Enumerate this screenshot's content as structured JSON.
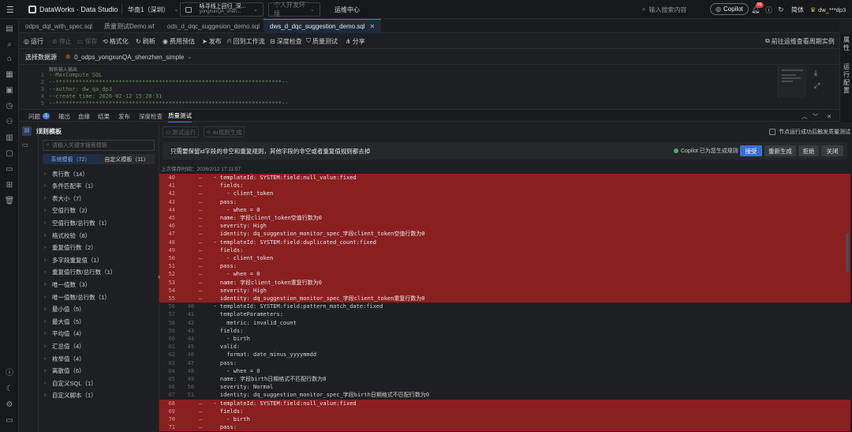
{
  "topbar": {
    "app_title": "DataWorks · Data Studio",
    "region": "华南1（深圳）",
    "workspace_name": "咏寻线上回归_深...",
    "workspace_sub": "yongxunQA_shen...",
    "env": "个人开发环境",
    "ops_center": "运维中心",
    "search_placeholder": "输入搜索内容",
    "copilot": "Copilot",
    "notif_badge": "99",
    "lang": "简体",
    "user": "dw_***dp3"
  },
  "tabs": [
    {
      "label": "odps_dql_with_spec.sql"
    },
    {
      "label": "质量测试Demo.wf"
    },
    {
      "label": "ods_d_dqc_suggesion_demo.sql"
    },
    {
      "label": "dws_d_dqc_suggestion_demo.sql",
      "active": true
    }
  ],
  "toolbar": {
    "run": "运行",
    "stop": "停止",
    "save": "保存",
    "format": "格式化",
    "refresh": "刷新",
    "cost": "费用预估",
    "publish": "发布",
    "back_to_flow": "回到工作流",
    "deep_check": "深度检查",
    "quality_test": "质量测试",
    "share": "分享",
    "goto_ops": "前往运维查看周期实例"
  },
  "datasource": {
    "label": "选择数据源",
    "value": "0_odps_yongxunQA_shenzhen_simple"
  },
  "editor": {
    "hint": "解析输入输出",
    "lines": [
      {
        "n": "1",
        "code": "--MaxCompute SQL"
      },
      {
        "n": "2",
        "code": "--********************************************************************--"
      },
      {
        "n": "3",
        "code": "--author: dw_qa_dp3"
      },
      {
        "n": "4",
        "code": "--create time: 2026-02-12 15:28:31"
      },
      {
        "n": "5",
        "code": "--********************************************************************--"
      }
    ]
  },
  "right_rail": {
    "attr": "属性",
    "run_config": "运行配置"
  },
  "panel_tabs": {
    "problems": "问题",
    "problems_count": "1",
    "output": "输出",
    "lineage": "血缘",
    "result": "结果",
    "publish": "发布",
    "deep_check": "深度检查",
    "quality_test": "质量测试"
  },
  "rules": {
    "title": "规则模板",
    "search_placeholder": "请输入关键字搜索模板",
    "tab_system": "系统模板（72）",
    "tab_custom": "自定义模板（11）",
    "items": [
      "表行数（14）",
      "条件匹配率（1）",
      "表大小（7）",
      "空值行数（2）",
      "空值行数/总行数（1）",
      "格式校验（8）",
      "重复值行数（2）",
      "多字段重复值（1）",
      "重复值行数/总行数（1）",
      "唯一值数（3）",
      "唯一值数/总行数（1）",
      "最小值（5）",
      "最大值（5）",
      "平均值（4）",
      "汇总值（4）",
      "枚举值（4）",
      "离散值（6）",
      "自定义SQL（1）",
      "自定义脚本（1）"
    ]
  },
  "quality": {
    "test_run": "测试运行",
    "ai_generate": "AI规则生成",
    "trigger_label": "节点运行成功后触发质量测试",
    "suggestion": "只需要保留id字段的非空和重复规则，其他字段的非空或者重复值规则都去掉",
    "copilot_status": "Copilot 已为您生成规则",
    "accept": "接受",
    "regenerate": "重新生成",
    "reject": "拒绝",
    "close": "关闭",
    "last_saved": "上次保存时间：2026/2/12 17:11:57"
  },
  "diff_lines": [
    {
      "o": "40",
      "n": "",
      "m": "—",
      "t": "  - templateId: SYSTEM:field:null_value:fixed",
      "del": true
    },
    {
      "o": "41",
      "n": "",
      "m": "—",
      "t": "    fields:",
      "del": true
    },
    {
      "o": "42",
      "n": "",
      "m": "—",
      "t": "      - client_token",
      "del": true
    },
    {
      "o": "43",
      "n": "",
      "m": "—",
      "t": "    pass:",
      "del": true
    },
    {
      "o": "44",
      "n": "",
      "m": "—",
      "t": "      - when = 0",
      "del": true
    },
    {
      "o": "45",
      "n": "",
      "m": "—",
      "t": "    name: 字段client_token空值行数为0",
      "del": true
    },
    {
      "o": "46",
      "n": "",
      "m": "—",
      "t": "    severity: High",
      "del": true
    },
    {
      "o": "47",
      "n": "",
      "m": "—",
      "t": "    identity: dq_suggestion_monitor_spec_字段client_token空值行数为0",
      "del": true
    },
    {
      "o": "48",
      "n": "",
      "m": "—",
      "t": "  - templateId: SYSTEM:field:duplicated_count:fixed",
      "del": true
    },
    {
      "o": "49",
      "n": "",
      "m": "—",
      "t": "    fields:",
      "del": true
    },
    {
      "o": "50",
      "n": "",
      "m": "—",
      "t": "      - client_token",
      "del": true
    },
    {
      "o": "51",
      "n": "",
      "m": "—",
      "t": "    pass:",
      "del": true
    },
    {
      "o": "52",
      "n": "",
      "m": "—",
      "t": "      - when = 0",
      "del": true
    },
    {
      "o": "53",
      "n": "",
      "m": "—",
      "t": "    name: 字段client_token重复行数为0",
      "del": true
    },
    {
      "o": "54",
      "n": "",
      "m": "—",
      "t": "    severity: High",
      "del": true
    },
    {
      "o": "55",
      "n": "",
      "m": "—",
      "t": "    identity: dq_suggestion_monitor_spec_字段client_token重复行数为0",
      "del": true
    },
    {
      "o": "56",
      "n": "40",
      "m": "",
      "t": "  - templateId: SYSTEM:field:pattern_match_date:fixed",
      "del": false
    },
    {
      "o": "57",
      "n": "41",
      "m": "",
      "t": "    templateParameters:",
      "del": false
    },
    {
      "o": "58",
      "n": "42",
      "m": "",
      "t": "      metric: invalid_count",
      "del": false
    },
    {
      "o": "59",
      "n": "43",
      "m": "",
      "t": "    fields:",
      "del": false
    },
    {
      "o": "60",
      "n": "44",
      "m": "",
      "t": "      - birth",
      "del": false
    },
    {
      "o": "61",
      "n": "45",
      "m": "",
      "t": "    valid:",
      "del": false
    },
    {
      "o": "62",
      "n": "46",
      "m": "",
      "t": "      format: date_minus_yyyymmdd",
      "del": false
    },
    {
      "o": "63",
      "n": "47",
      "m": "",
      "t": "    pass:",
      "del": false
    },
    {
      "o": "64",
      "n": "48",
      "m": "",
      "t": "      - when = 0",
      "del": false
    },
    {
      "o": "65",
      "n": "49",
      "m": "",
      "t": "    name: 字段birth日期格式不匹配行数为0",
      "del": false
    },
    {
      "o": "66",
      "n": "50",
      "m": "",
      "t": "    severity: Normal",
      "del": false
    },
    {
      "o": "67",
      "n": "51",
      "m": "",
      "t": "    identity: dq_suggestion_monitor_spec_字段birth日期格式不匹配行数为0",
      "del": false
    },
    {
      "o": "68",
      "n": "",
      "m": "—",
      "t": "  - templateId: SYSTEM:field:null_value:fixed",
      "del": true
    },
    {
      "o": "69",
      "n": "",
      "m": "—",
      "t": "    fields:",
      "del": true
    },
    {
      "o": "70",
      "n": "",
      "m": "—",
      "t": "      - birth",
      "del": true
    },
    {
      "o": "71",
      "n": "",
      "m": "—",
      "t": "    pass:",
      "del": true
    }
  ],
  "colors": {
    "accent": "#4a7fd4",
    "deleted_bg": "#8a1f1f",
    "copilot_green": "#3bb36b"
  }
}
